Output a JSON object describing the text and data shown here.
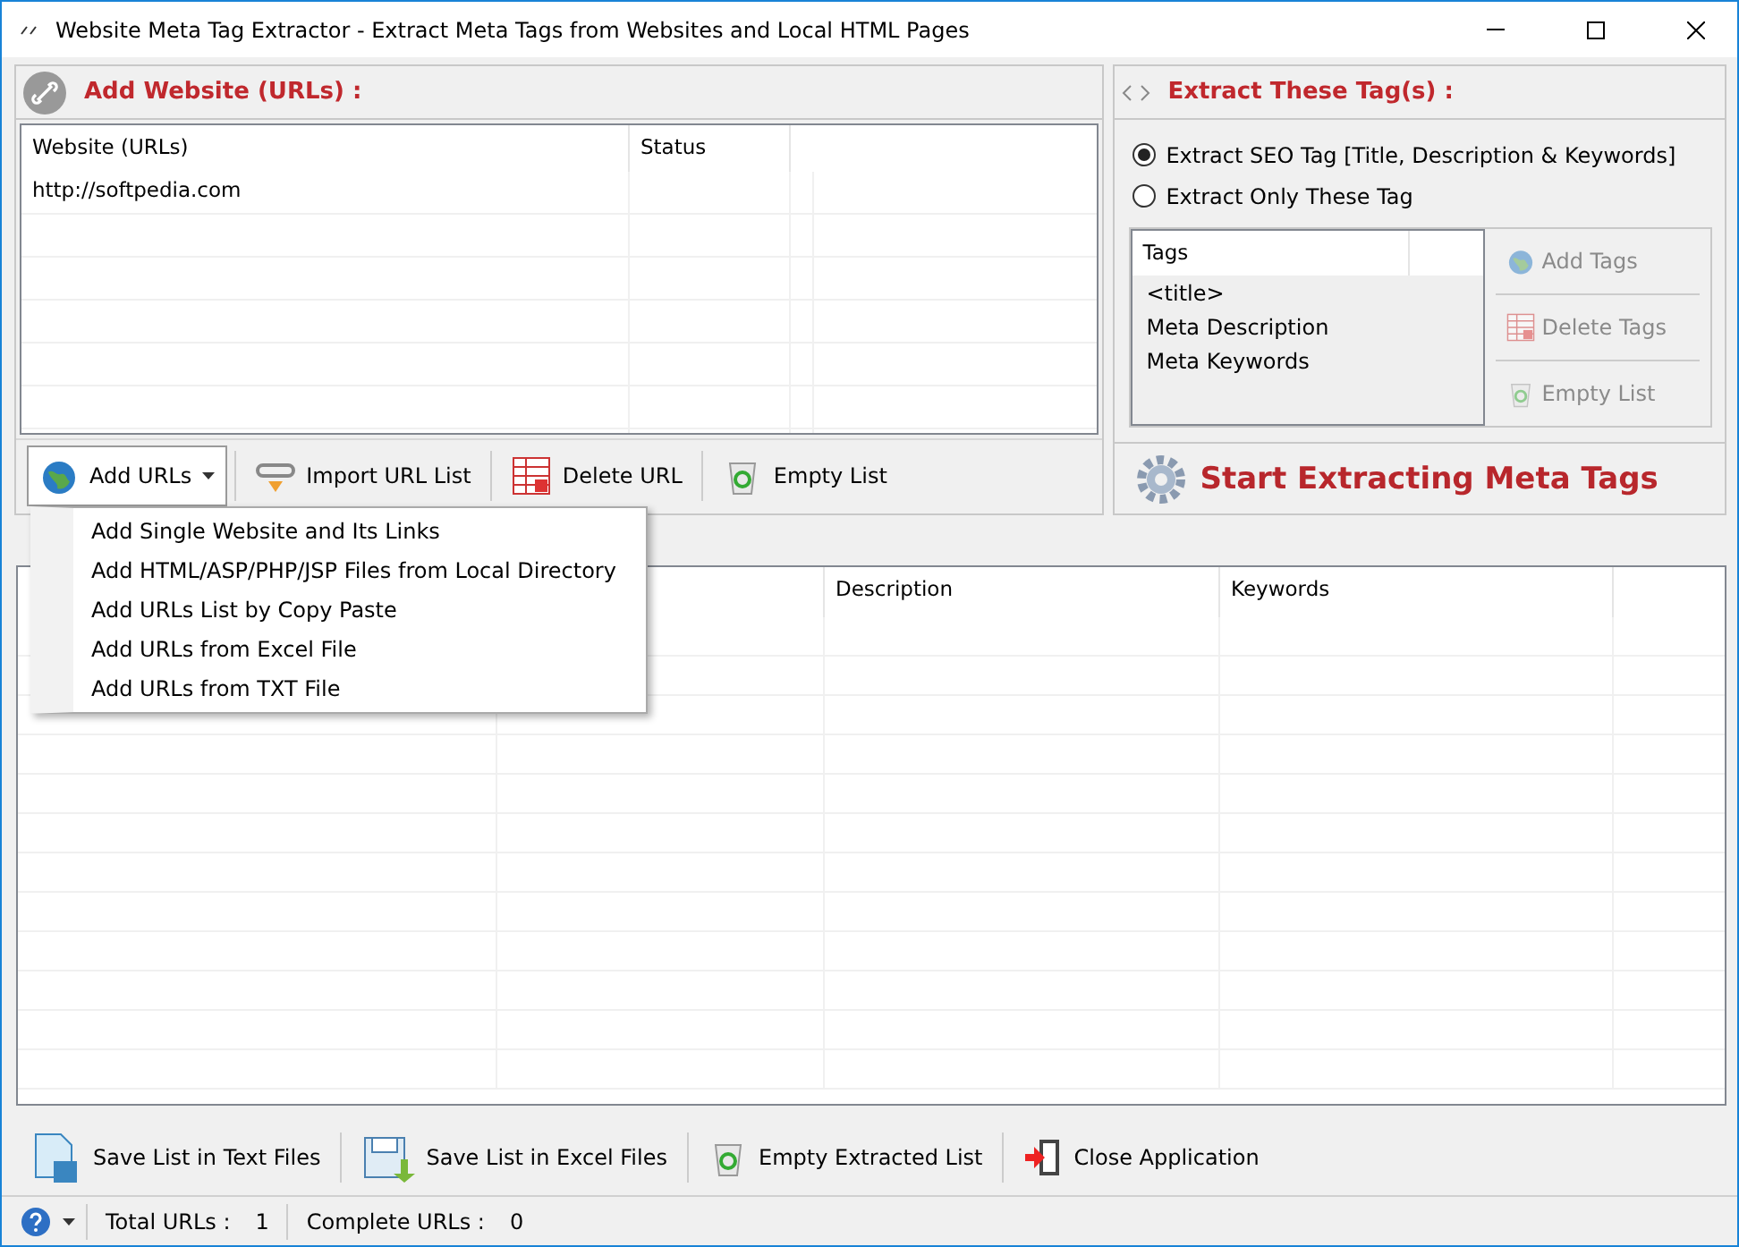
{
  "window": {
    "title": "Website Meta Tag Extractor - Extract Meta Tags from Websites and Local HTML Pages"
  },
  "url_panel": {
    "title": "Add Website (URLs) :",
    "columns": [
      "Website (URLs)",
      "Status"
    ],
    "rows": [
      {
        "url": "http://softpedia.com"
      }
    ],
    "toolbar": [
      {
        "label": "Add URLs",
        "kind": "add",
        "pressed": true
      },
      {
        "label": "Import URL List",
        "kind": "import",
        "pressed": false
      },
      {
        "label": "Delete URL",
        "kind": "delete",
        "pressed": false
      },
      {
        "label": "Empty List",
        "kind": "recycle",
        "pressed": false
      }
    ]
  },
  "add_menu": [
    "Add Single Website and Its Links",
    "Add HTML/ASP/PHP/JSP Files from Local Directory",
    "Add URLs List by Copy Paste",
    "Add URLs from Excel File",
    "Add URLs from TXT File"
  ],
  "tag_panel": {
    "title": "Extract These Tag(s) :",
    "options": [
      {
        "label": "Extract SEO Tag [Title, Description & Keywords]",
        "selected": true
      },
      {
        "label": "Extract Only These Tag",
        "selected": false
      }
    ],
    "tags_column": "Tags",
    "tags": [
      "<title>",
      "Meta Description",
      "Meta Keywords"
    ],
    "actions": [
      {
        "label": "Add Tags",
        "kind": "add"
      },
      {
        "label": "Delete Tags",
        "kind": "delete"
      },
      {
        "label": "Empty List",
        "kind": "recycle"
      }
    ],
    "start": "Start Extracting Meta Tags"
  },
  "results": {
    "columns": [
      "Description",
      "Keywords"
    ]
  },
  "bottom_toolbar": [
    {
      "label": "Save List in Text Files",
      "kind": "text"
    },
    {
      "label": "Save List in Excel Files",
      "kind": "excel"
    },
    {
      "label": "Empty Extracted List",
      "kind": "recycle"
    },
    {
      "label": "Close Application",
      "kind": "exit"
    }
  ],
  "status_bar": [
    {
      "label": "Total URLs :",
      "value": "1"
    },
    {
      "label": "Complete URLs :",
      "value": "0"
    }
  ]
}
